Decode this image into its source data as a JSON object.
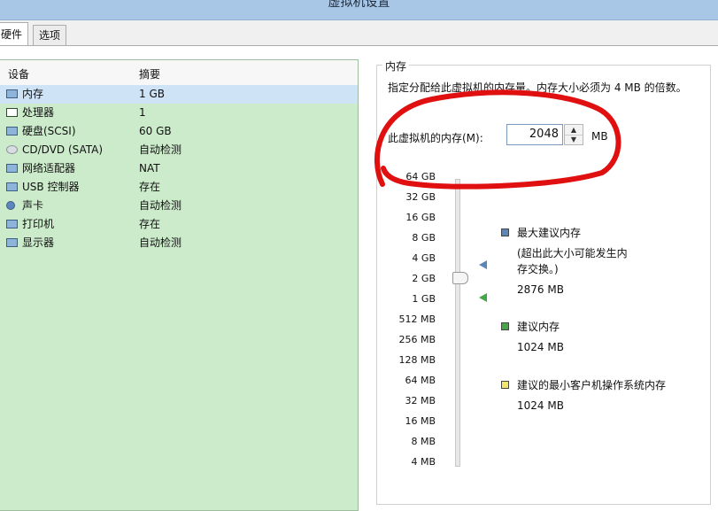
{
  "window": {
    "title": "虚拟机设置"
  },
  "tabs": [
    {
      "label": "硬件"
    },
    {
      "label": "选项"
    }
  ],
  "device_list": {
    "headers": {
      "device": "设备",
      "summary": "摘要"
    },
    "rows": [
      {
        "device": "内存",
        "summary": "1 GB",
        "icon": "memory-icon"
      },
      {
        "device": "处理器",
        "summary": "1",
        "icon": "cpu-icon"
      },
      {
        "device": "硬盘(SCSI)",
        "summary": "60 GB",
        "icon": "harddisk-icon"
      },
      {
        "device": "CD/DVD (SATA)",
        "summary": "自动检测",
        "icon": "cd-dvd-icon"
      },
      {
        "device": "网络适配器",
        "summary": "NAT",
        "icon": "network-adapter-icon"
      },
      {
        "device": "USB 控制器",
        "summary": "存在",
        "icon": "usb-icon"
      },
      {
        "device": "声卡",
        "summary": "自动检测",
        "icon": "sound-card-icon"
      },
      {
        "device": "打印机",
        "summary": "存在",
        "icon": "printer-icon"
      },
      {
        "device": "显示器",
        "summary": "自动检测",
        "icon": "display-icon"
      }
    ]
  },
  "memory": {
    "group_title": "内存",
    "description": "指定分配给此虚拟机的内存量。内存大小必须为 4 MB 的倍数。",
    "input_label": "此虚拟机的内存(M):",
    "value": "2048",
    "unit": "MB",
    "scale": [
      "64 GB",
      "32 GB",
      "16 GB",
      "8 GB",
      "4 GB",
      "2 GB",
      "1 GB",
      "512 MB",
      "256 MB",
      "128 MB",
      "64 MB",
      "32 MB",
      "16 MB",
      "8 MB",
      "4 MB"
    ],
    "legend": {
      "max": {
        "title": "最大建议内存",
        "note": "(超出此大小可能发生内存交换。)",
        "value": "2876 MB",
        "color": "#5b86b8"
      },
      "recommended": {
        "title": "建议内存",
        "value": "1024 MB",
        "color": "#47a447"
      },
      "min_guest": {
        "title": "建议的最小客户机操作系统内存",
        "value": "1024 MB",
        "color": "#f2e66a"
      }
    }
  },
  "annotation_color": "#e01010"
}
